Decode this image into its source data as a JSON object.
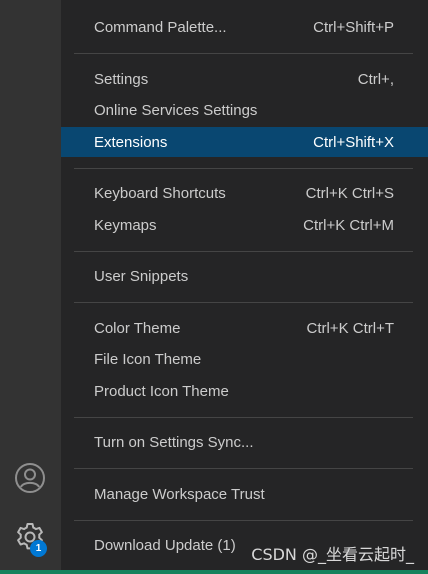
{
  "activity_bar": {
    "badge_count": "1",
    "icons": [
      "account-icon",
      "gear-icon"
    ]
  },
  "menu": {
    "items": [
      {
        "label": "Command Palette...",
        "shortcut": "Ctrl+Shift+P"
      },
      {
        "label": "Settings",
        "shortcut": "Ctrl+,"
      },
      {
        "label": "Online Services Settings",
        "shortcut": ""
      },
      {
        "label": "Extensions",
        "shortcut": "Ctrl+Shift+X",
        "active": true
      },
      {
        "label": "Keyboard Shortcuts",
        "shortcut": "Ctrl+K Ctrl+S"
      },
      {
        "label": "Keymaps",
        "shortcut": "Ctrl+K Ctrl+M"
      },
      {
        "label": "User Snippets",
        "shortcut": ""
      },
      {
        "label": "Color Theme",
        "shortcut": "Ctrl+K Ctrl+T"
      },
      {
        "label": "File Icon Theme",
        "shortcut": ""
      },
      {
        "label": "Product Icon Theme",
        "shortcut": ""
      },
      {
        "label": "Turn on Settings Sync...",
        "shortcut": ""
      },
      {
        "label": "Manage Workspace Trust",
        "shortcut": ""
      },
      {
        "label": "Download Update (1)",
        "shortcut": ""
      }
    ]
  },
  "watermark": "CSDN @_坐看云起时_",
  "colors": {
    "menu_background": "#252526",
    "activity_bar_background": "#333333",
    "active_item_background": "#094771",
    "text": "#cccccc",
    "separator": "#454545",
    "badge": "#0078d4",
    "status_strip": "#16825d"
  }
}
